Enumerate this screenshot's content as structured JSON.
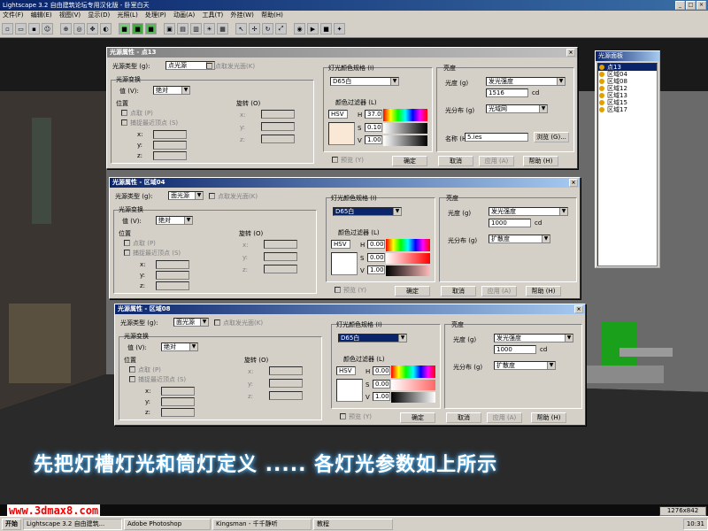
{
  "app": {
    "title": "Lightscape 3.2 自由建筑论坛专用汉化版 - 卧室白天"
  },
  "menu": [
    "文件(F)",
    "编辑(E)",
    "视图(V)",
    "显示(D)",
    "光照(L)",
    "处理(P)",
    "动画(A)",
    "工具(T)",
    "外挂(W)",
    "帮助(H)"
  ],
  "dialog_common": {
    "source_type_label": "光源类型 (g):",
    "light_surface_label": "点取发光面(K)",
    "transform_group": "光源变换",
    "value_label": "值 (V):",
    "value_option": "绝对",
    "position_group": "位置",
    "pick_label": "点取 (P)",
    "snap_label": "捕捉最近顶点 (S)",
    "x": "x:",
    "y": "y:",
    "z": "z:",
    "rotation_group": "旋转 (O)",
    "color_spec_group": "灯光颜色规格 (I)",
    "color_spec_value": "D65白",
    "filter_label": "颜色过滤器 (L)",
    "hsv": "HSV",
    "H": "H",
    "S": "S",
    "V": "V",
    "brightness_group": "亮度",
    "intensity_label": "光度 (g)",
    "dist_label": "光分布 (g)",
    "cd": "cd",
    "preview": "预览 (Y)",
    "ok": "确定",
    "cancel": "取消",
    "apply": "应用 (A)",
    "help": "帮助 (H)",
    "name_label": "名称 (H)",
    "browse": "浏览 (G)..."
  },
  "dialogs": [
    {
      "title": "光源属性 - 点13",
      "type": "点光源",
      "intensity_mode": "发光强度",
      "intensity": "1516",
      "dist": "光域网",
      "name": "5.ies",
      "h": "37.0",
      "s": "0.10",
      "v": "1.00",
      "swatch": "#f9e8d6"
    },
    {
      "title": "光源属性 - 区域04",
      "type": "面光源",
      "intensity_mode": "发光强度",
      "intensity": "1000",
      "dist": "扩散度",
      "h": "0.00",
      "s": "0.00",
      "v": "1.00",
      "swatch": "#ffffff"
    },
    {
      "title": "光源属性 - 区域08",
      "type": "面光源",
      "intensity_mode": "发光强度",
      "intensity": "1000",
      "dist": "扩散度",
      "h": "0.00",
      "s": "0.00",
      "v": "1.00",
      "swatch": "#ffffff"
    }
  ],
  "panel": {
    "title": "光源面板",
    "items": [
      "点13",
      "区域04",
      "区域08",
      "区域12",
      "区域13",
      "区域15",
      "区域17"
    ]
  },
  "caption": "先把灯槽灯光和筒灯定义 ..... 各灯光参数如上所示",
  "watermark": "www.3dmax8.com",
  "status": "1276x842",
  "taskbar": {
    "start": "开始",
    "tasks": [
      "Lightscape 3.2 自由建筑...",
      "Adobe Photoshop",
      "Kingsman - 千千静听",
      "教程"
    ],
    "clock": "10:31"
  }
}
